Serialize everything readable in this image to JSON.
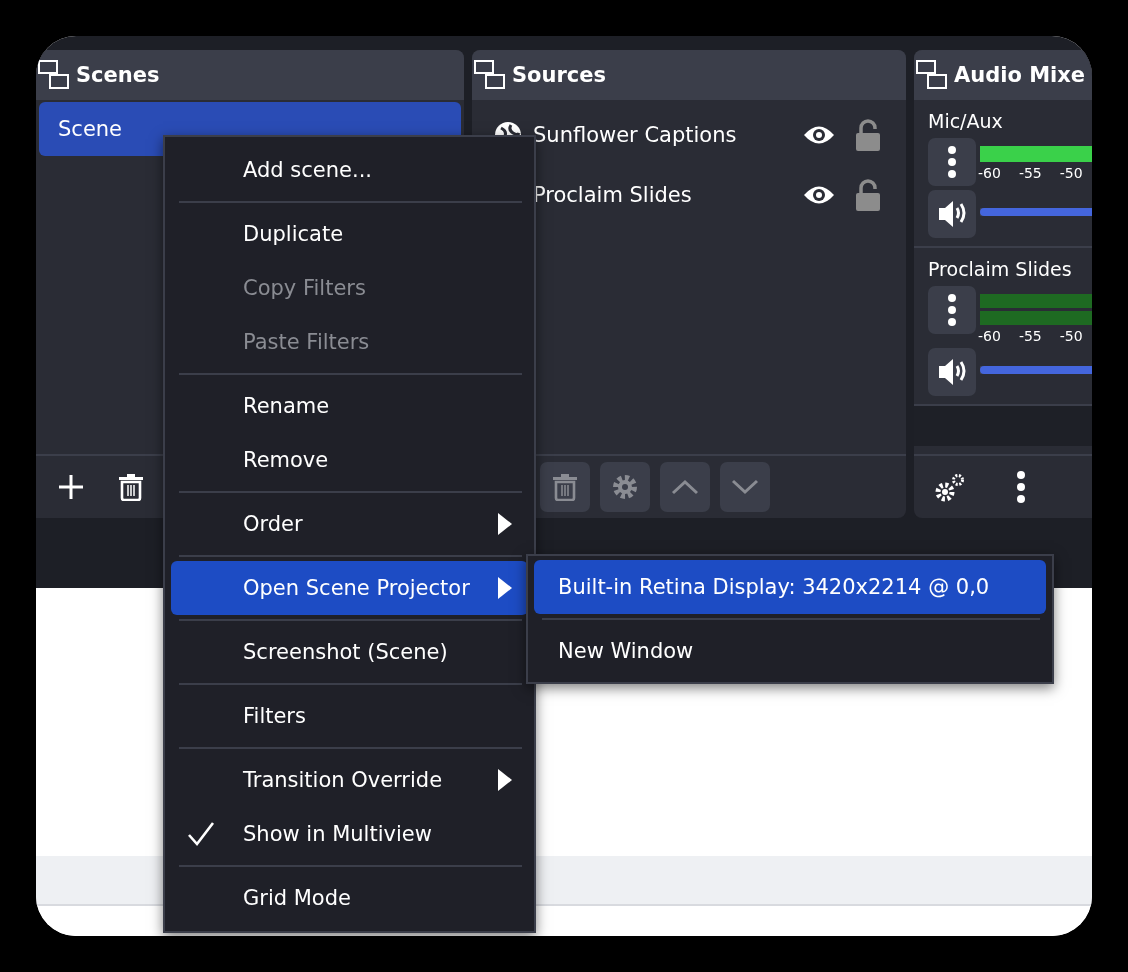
{
  "scenes_panel": {
    "title": "Scenes",
    "items": [
      {
        "label": "Scene",
        "selected": true
      }
    ]
  },
  "sources_panel": {
    "title": "Sources",
    "items": [
      {
        "label": "Sunflower Captions",
        "visible": true,
        "locked": false
      },
      {
        "label": "Proclaim Slides",
        "visible": true,
        "locked": false
      }
    ]
  },
  "audio_mixer": {
    "title": "Audio Mixe",
    "channels": [
      {
        "name": "Mic/Aux",
        "active": true,
        "level": 1,
        "ticks": [
          "-60",
          "-55",
          "-50"
        ]
      },
      {
        "name": "Proclaim Slides",
        "active": false,
        "level": 1,
        "ticks": [
          "-60",
          "-55",
          "-50"
        ]
      }
    ]
  },
  "context_menu": {
    "items": [
      {
        "kind": "item",
        "label": "Add scene...",
        "disabled": false,
        "submenu": false,
        "checked": false,
        "selected": false
      },
      {
        "kind": "separator"
      },
      {
        "kind": "item",
        "label": "Duplicate",
        "disabled": false,
        "submenu": false,
        "checked": false,
        "selected": false
      },
      {
        "kind": "item",
        "label": "Copy Filters",
        "disabled": true,
        "submenu": false,
        "checked": false,
        "selected": false
      },
      {
        "kind": "item",
        "label": "Paste Filters",
        "disabled": true,
        "submenu": false,
        "checked": false,
        "selected": false
      },
      {
        "kind": "separator"
      },
      {
        "kind": "item",
        "label": "Rename",
        "disabled": false,
        "submenu": false,
        "checked": false,
        "selected": false
      },
      {
        "kind": "item",
        "label": "Remove",
        "disabled": false,
        "submenu": false,
        "checked": false,
        "selected": false
      },
      {
        "kind": "separator"
      },
      {
        "kind": "item",
        "label": "Order",
        "disabled": false,
        "submenu": true,
        "checked": false,
        "selected": false
      },
      {
        "kind": "separator"
      },
      {
        "kind": "item",
        "label": "Open Scene Projector",
        "disabled": false,
        "submenu": true,
        "checked": false,
        "selected": true
      },
      {
        "kind": "separator"
      },
      {
        "kind": "item",
        "label": "Screenshot (Scene)",
        "disabled": false,
        "submenu": false,
        "checked": false,
        "selected": false
      },
      {
        "kind": "separator"
      },
      {
        "kind": "item",
        "label": "Filters",
        "disabled": false,
        "submenu": false,
        "checked": false,
        "selected": false
      },
      {
        "kind": "separator"
      },
      {
        "kind": "item",
        "label": "Transition Override",
        "disabled": false,
        "submenu": true,
        "checked": false,
        "selected": false
      },
      {
        "kind": "item",
        "label": "Show in Multiview",
        "disabled": false,
        "submenu": false,
        "checked": true,
        "selected": false
      },
      {
        "kind": "separator"
      },
      {
        "kind": "item",
        "label": "Grid Mode",
        "disabled": false,
        "submenu": false,
        "checked": false,
        "selected": false
      }
    ]
  },
  "projector_submenu": {
    "items": [
      {
        "kind": "item",
        "label": "Built-in Retina Display: 3420x2214 @ 0,0",
        "selected": true
      },
      {
        "kind": "separator"
      },
      {
        "kind": "item",
        "label": "New Window",
        "selected": false
      }
    ]
  }
}
